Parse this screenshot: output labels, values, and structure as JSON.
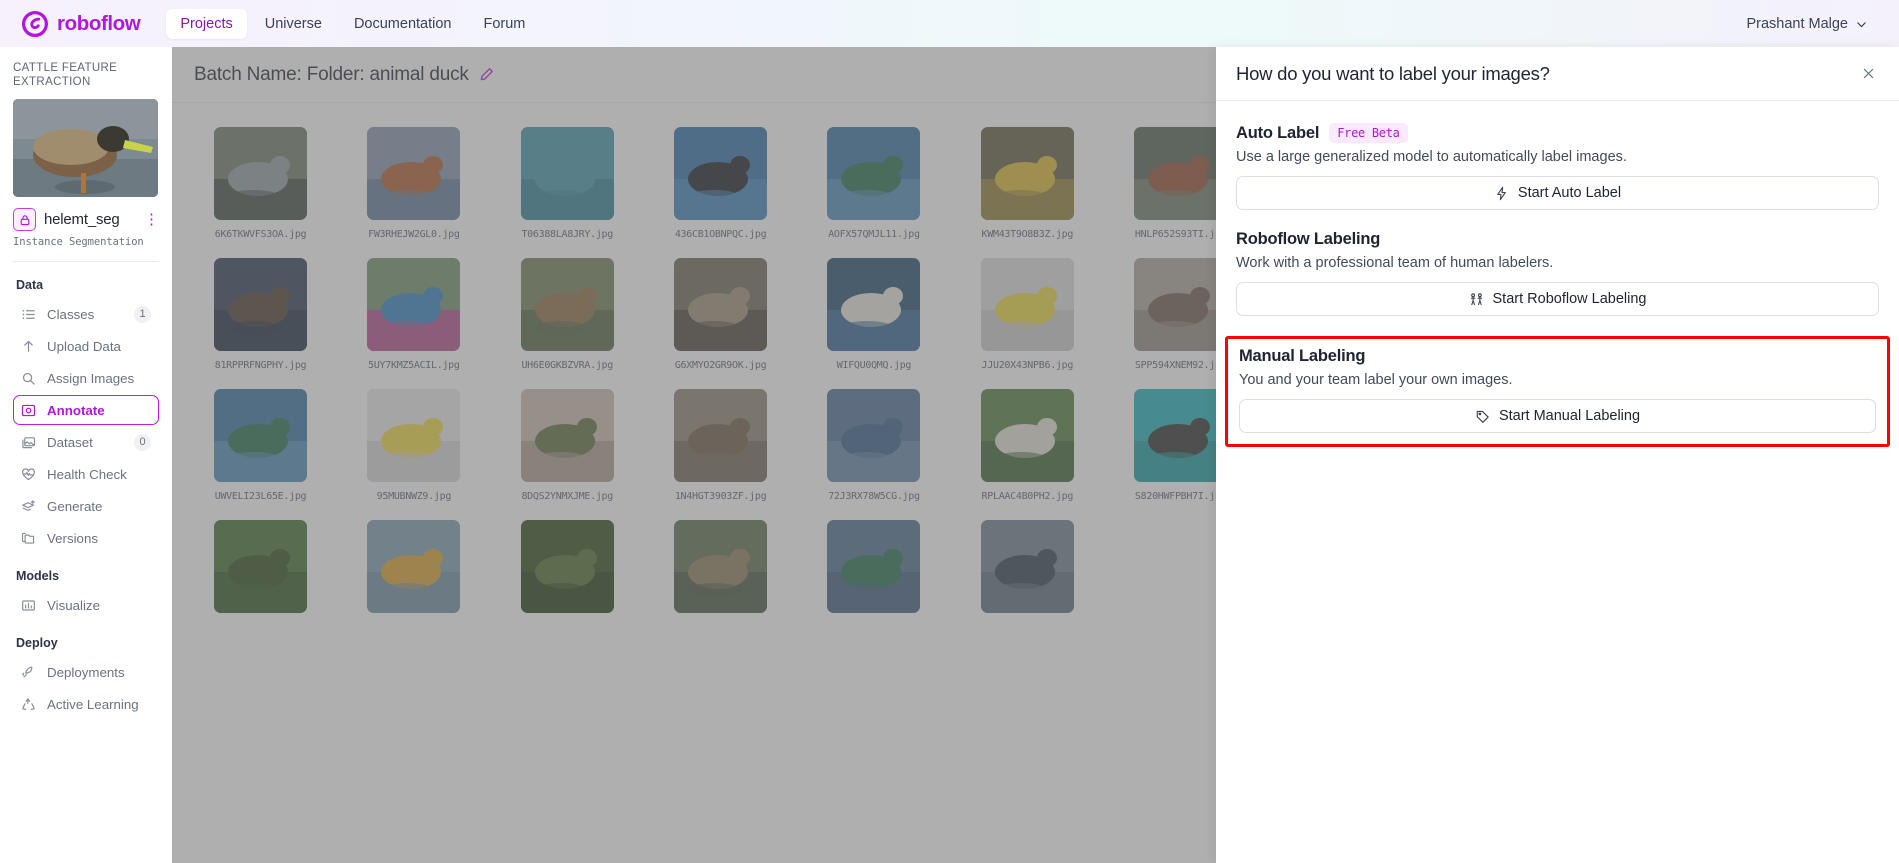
{
  "topbar": {
    "brand": "roboflow",
    "brand_icon": "roboflow-logo-icon",
    "nav": [
      {
        "label": "Projects",
        "active": true
      },
      {
        "label": "Universe",
        "active": false
      },
      {
        "label": "Documentation",
        "active": false
      },
      {
        "label": "Forum",
        "active": false
      }
    ],
    "user": "Prashant Malge",
    "chevron_icon": "chevron-down-icon"
  },
  "sidebar": {
    "workspace": "CATTLE FEATURE EXTRACTION",
    "project_name": "helemt_seg",
    "project_type": "Instance Segmentation",
    "lock_icon": "lock-icon",
    "menu_icon": "kebab-menu-icon",
    "sections": [
      {
        "title": "Data",
        "items": [
          {
            "label": "Classes",
            "icon": "list-icon",
            "count": "1",
            "selected": false
          },
          {
            "label": "Upload Data",
            "icon": "upload-icon",
            "count": "",
            "selected": false
          },
          {
            "label": "Assign Images",
            "icon": "search-icon",
            "count": "",
            "selected": false
          },
          {
            "label": "Annotate",
            "icon": "annotate-icon",
            "count": "",
            "selected": true
          },
          {
            "label": "Dataset",
            "icon": "images-icon",
            "count": "0",
            "selected": false
          },
          {
            "label": "Health Check",
            "icon": "heartbeat-icon",
            "count": "",
            "selected": false
          },
          {
            "label": "Generate",
            "icon": "layers-icon",
            "count": "",
            "selected": false
          },
          {
            "label": "Versions",
            "icon": "folders-icon",
            "count": "",
            "selected": false
          }
        ]
      },
      {
        "title": "Models",
        "items": [
          {
            "label": "Visualize",
            "icon": "bar-chart-icon",
            "count": "",
            "selected": false
          }
        ]
      },
      {
        "title": "Deploy",
        "items": [
          {
            "label": "Deployments",
            "icon": "rocket-icon",
            "count": "",
            "selected": false
          },
          {
            "label": "Active Learning",
            "icon": "recycle-icon",
            "count": "",
            "selected": false
          }
        ]
      }
    ]
  },
  "main": {
    "batch_title": "Batch Name: Folder: animal duck",
    "edit_icon": "edit-pencil-icon",
    "images": [
      {
        "file": "6K6TKWVFS3OA.jpg",
        "c1": "#6b7866",
        "c2": "#8e9aa0",
        "c3": "#3f4a43"
      },
      {
        "file": "FW3RHEJW2GL0.jpg",
        "c1": "#7f93ac",
        "c2": "#b05a2e",
        "c3": "#5e7894"
      },
      {
        "file": "T06388LA8JRY.jpg",
        "c1": "#3e93a8",
        "c2": "#3e93a8",
        "c3": "#2d7f93"
      },
      {
        "file": "436CB1OBNPQC.jpg",
        "c1": "#2e6ea8",
        "c2": "#141a1f",
        "c3": "#3b7fb8"
      },
      {
        "file": "AOFX57QMJL11.jpg",
        "c1": "#2f6fa2",
        "c2": "#1d6b4b",
        "c3": "#4b87b4"
      },
      {
        "file": "KWM43T9O8B3Z.jpg",
        "c1": "#5e5a3c",
        "c2": "#d9b62e",
        "c3": "#8d7a32"
      },
      {
        "file": "HNLP652S93TI.jpg",
        "c1": "#4e5c4e",
        "c2": "#8e4a2a",
        "c3": "#6b7566"
      },
      {
        "file": "CVP1867DZM.jpg",
        "c1": "#8a8070",
        "c2": "#2f3b2e",
        "c3": "#4f7a3a"
      },
      {
        "file": "R9WXNI48EDKE.jpg",
        "c1": "#9aa099",
        "c2": "#e6e6e0",
        "c3": "#6f7a6b"
      },
      {
        "file": "LKRDTT7JT8F2.jpg",
        "c1": "#1c1a18",
        "c2": "#ddd8cf",
        "c3": "#2a2623"
      },
      {
        "file": "BNSEMPMQQCFP.jpg",
        "c1": "#d8d3c7",
        "c2": "#6a4436",
        "c3": "#b9b2a4"
      },
      {
        "file": "81RPPRFNGPHY.jpg",
        "c1": "#2b3a55",
        "c2": "#4a3a2c",
        "c3": "#1d2a40"
      },
      {
        "file": "5UY7KMZ5ACIL.jpg",
        "c1": "#6f8f6a",
        "c2": "#2e7fbf",
        "c3": "#b04a8c"
      },
      {
        "file": "UH6E0GKBZVRA.jpg",
        "c1": "#6d7f55",
        "c2": "#8a6a42",
        "c3": "#4e6240"
      },
      {
        "file": "G6XMYO2GR9OK.jpg",
        "c1": "#6a6256",
        "c2": "#9b8d74",
        "c3": "#4a4439"
      },
      {
        "file": "WIFQU0QMQ.jpg",
        "c1": "#21496e",
        "c2": "#e8e4dc",
        "c3": "#2f6090"
      },
      {
        "file": "JJU20X43NPB6.jpg",
        "c1": "#dcdcdc",
        "c2": "#e8d63a",
        "c3": "#c9c9c9"
      },
      {
        "file": "SPP594XNEM92.jpg",
        "c1": "#a9a096",
        "c2": "#6a5a48",
        "c3": "#8e857a"
      },
      {
        "file": "M1W3P0KKVPJ8.jpg",
        "c1": "#2f5e86",
        "c2": "#8a7a55",
        "c3": "#3f6e96"
      },
      {
        "file": "EGOABBNX55N1.jpg",
        "c1": "#4a5a36",
        "c2": "#7a6a4a",
        "c3": "#34411f"
      },
      {
        "file": "TZKWMPTTD6D9.jpg",
        "c1": "#6a6f60",
        "c2": "#d8d4cb",
        "c3": "#4e5448"
      },
      {
        "file": "JNKE4FMZ2WYF.jpg",
        "c1": "#2b4a6e",
        "c2": "#a85a2a",
        "c3": "#35587f"
      },
      {
        "file": "UWVELI23L65E.jpg",
        "c1": "#2f6fa2",
        "c2": "#1d6b4b",
        "c3": "#4b87b4"
      },
      {
        "file": "95MUBNWZ9.jpg",
        "c1": "#e8e8e8",
        "c2": "#f0d83a",
        "c3": "#d4d4d4"
      },
      {
        "file": "8DQS2YNMXJME.jpg",
        "c1": "#c9b9ae",
        "c2": "#5a6a3a",
        "c3": "#a89a8e"
      },
      {
        "file": "1N4HGT3903ZF.jpg",
        "c1": "#8a7f6e",
        "c2": "#6a5a46",
        "c3": "#6e6254"
      },
      {
        "file": "72J3RX78W5CG.jpg",
        "c1": "#4a6e96",
        "c2": "#2f5a86",
        "c3": "#5f80a6"
      },
      {
        "file": "RPLAAC4B0PH2.jpg",
        "c1": "#4e7a3a",
        "c2": "#e4e0d6",
        "c3": "#3b6030"
      },
      {
        "file": "S820HWFPBH7I.jpg",
        "c1": "#1ab0b8",
        "c2": "#2a2a2a",
        "c3": "#14989f"
      },
      {
        "file": "XHG5KH84BE0F.jpg",
        "c1": "#6a6a5a",
        "c2": "#2f5a3a",
        "c3": "#4e4e42"
      },
      {
        "file": "1BGGCGY5ANJ3.jpg",
        "c1": "#4e7a3a",
        "c2": "#2a3a2a",
        "c3": "#3b6030"
      },
      {
        "file": "7WMDKAVL2.jpg",
        "c1": "#c9b0a0",
        "c2": "#6a4436",
        "c3": "#a8917f"
      },
      {
        "file": "",
        "c1": "#b09a7a",
        "c2": "#8a6a4a",
        "c3": "#96805f"
      },
      {
        "file": "",
        "c1": "#3f6a2a",
        "c2": "#2a4a1a",
        "c3": "#2f5520"
      },
      {
        "file": "",
        "c1": "#7a9ab0",
        "c2": "#d8a02a",
        "c3": "#6a8aa0"
      },
      {
        "file": "",
        "c1": "#2a4a1a",
        "c2": "#4a6a2a",
        "c3": "#1f3a12"
      },
      {
        "file": "",
        "c1": "#5a6a4a",
        "c2": "#8a7a5a",
        "c3": "#44523a"
      },
      {
        "file": "",
        "c1": "#4a6a8a",
        "c2": "#1d6b4b",
        "c3": "#3a5a7a"
      },
      {
        "file": "",
        "c1": "#6a7a8a",
        "c2": "#2a3a4a",
        "c3": "#5a6a7a"
      }
    ]
  },
  "drawer": {
    "title": "How do you want to label your images?",
    "close_icon": "close-icon",
    "options": [
      {
        "name": "Auto Label",
        "badge": "Free Beta",
        "desc": "Use a large generalized model to automatically label images.",
        "button": "Start Auto Label",
        "button_icon": "lightning-bolt-icon",
        "highlighted": false
      },
      {
        "name": "Roboflow Labeling",
        "badge": "",
        "desc": "Work with a professional team of human labelers.",
        "button": "Start Roboflow Labeling",
        "button_icon": "people-icon",
        "highlighted": false
      },
      {
        "name": "Manual Labeling",
        "badge": "",
        "desc": "You and your team label your own images.",
        "button": "Start Manual Labeling",
        "button_icon": "tag-icon",
        "highlighted": true
      }
    ]
  },
  "colors": {
    "accent": "#b215e0",
    "highlight_box": "#fb0007",
    "text_primary": "#1e2431",
    "text_muted": "#6b7280"
  }
}
